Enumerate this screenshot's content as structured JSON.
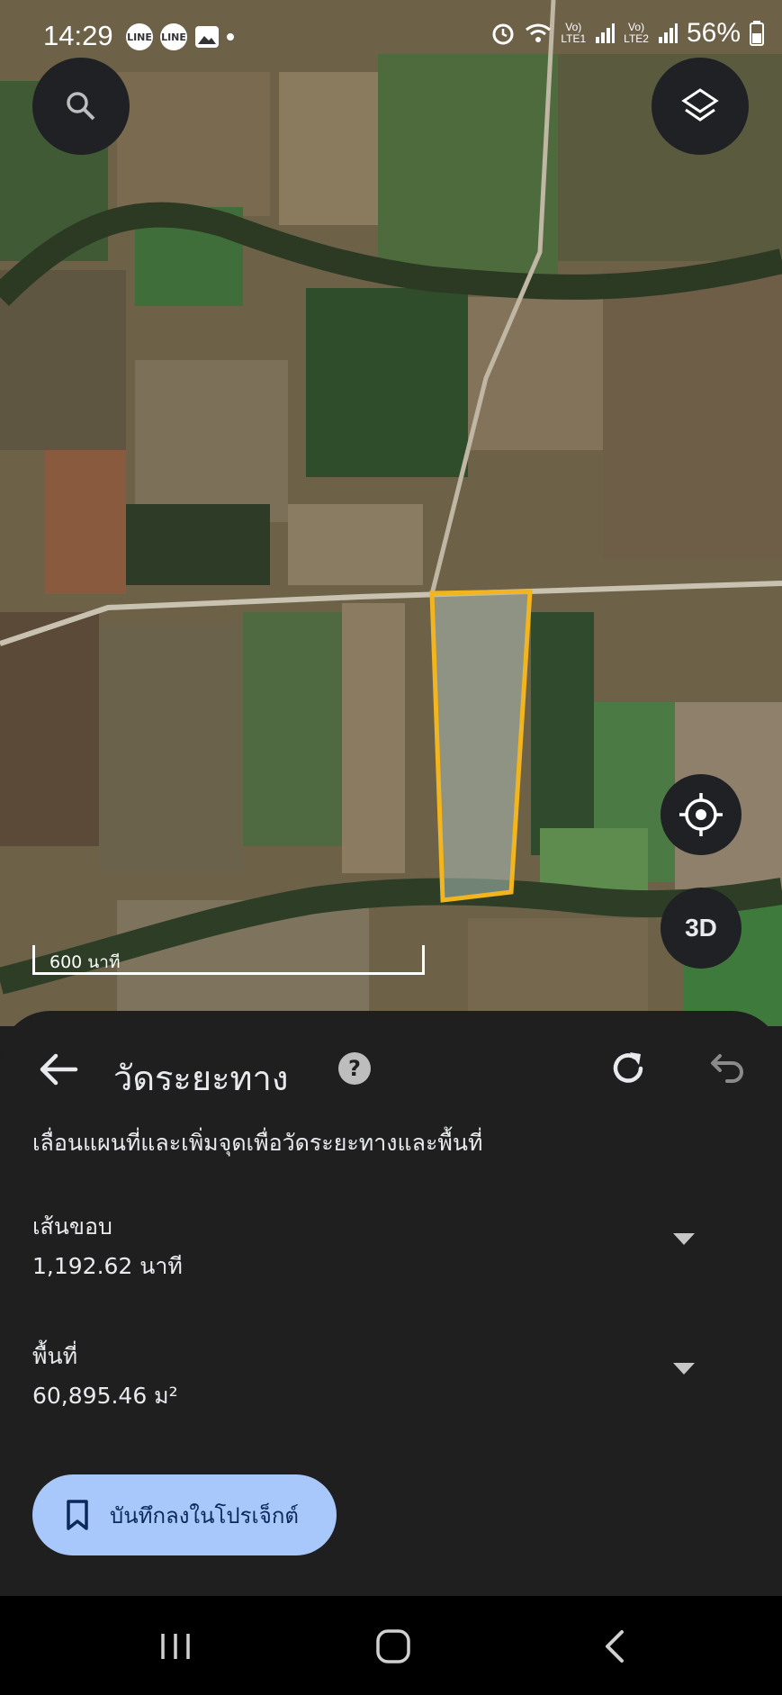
{
  "status_bar": {
    "time": "14:29",
    "notifications": [
      "LINE",
      "LINE",
      "gallery-icon"
    ],
    "sim1": "LTE1",
    "sim2": "LTE2",
    "battery": "56%"
  },
  "map": {
    "scale_label": "600 นาที",
    "buttons": [
      "search-icon",
      "layers-icon",
      "my-location-icon"
    ],
    "view_3d_label": "3D",
    "polygon_color": "#f2b51e"
  },
  "measure_panel": {
    "title": "วัดระยะทาง",
    "help_label": "?",
    "instruction": "เลื่อนแผนที่และเพิ่มจุดเพื่อวัดระยะทางและพื้นที่",
    "perimeter": {
      "label": "เส้นขอบ",
      "value": "1,192.62 นาที"
    },
    "area": {
      "label": "พื้นที่",
      "value": "60,895.46 ม²"
    },
    "save_button_label": "บันทึกลงในโปรเจ็กต์"
  },
  "nav_bar": {
    "buttons": [
      "recents-icon",
      "home-icon",
      "back-icon"
    ]
  },
  "colors": {
    "sheet_bg": "#1f1f1f",
    "save_button": "#a8c7fa",
    "text": "#e8eaed"
  }
}
